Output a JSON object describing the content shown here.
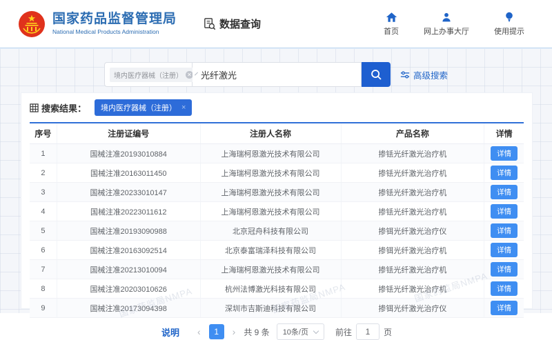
{
  "header": {
    "org_name_zh": "国家药品监督管理局",
    "org_name_en": "National Medical Products Administration",
    "app_title": "数据查询",
    "nav": [
      {
        "label": "首页",
        "icon": "home-icon"
      },
      {
        "label": "网上办事大厅",
        "icon": "user-icon"
      },
      {
        "label": "使用提示",
        "icon": "tip-icon"
      }
    ]
  },
  "search": {
    "category_tag": "境内医疗器械（注册）",
    "query": "光纤激光",
    "advanced_label": "高级搜索"
  },
  "results": {
    "label": "搜索结果：",
    "filter_tag": "境内医疗器械（注册）",
    "columns": [
      "序号",
      "注册证编号",
      "注册人名称",
      "产品名称",
      "详情"
    ],
    "detail_label": "详情",
    "rows": [
      {
        "no": "1",
        "cert": "国械注准20193010884",
        "registrant": "上海瑞柯恩激光技术有限公司",
        "product": "掺铥光纤激光治疗机"
      },
      {
        "no": "2",
        "cert": "国械注准20163011450",
        "registrant": "上海瑞柯恩激光技术有限公司",
        "product": "掺铥光纤激光治疗机"
      },
      {
        "no": "3",
        "cert": "国械注准20233010147",
        "registrant": "上海瑞柯恩激光技术有限公司",
        "product": "掺铥光纤激光治疗机"
      },
      {
        "no": "4",
        "cert": "国械注准20223011612",
        "registrant": "上海瑞柯恩激光技术有限公司",
        "product": "掺铥光纤激光治疗机"
      },
      {
        "no": "5",
        "cert": "国械注准20193090988",
        "registrant": "北京冠舟科技有限公司",
        "product": "掺铒光纤激光治疗仪"
      },
      {
        "no": "6",
        "cert": "国械注准20163092514",
        "registrant": "北京泰富瑞泽科技有限公司",
        "product": "掺铒光纤激光治疗机"
      },
      {
        "no": "7",
        "cert": "国械注准20213010094",
        "registrant": "上海瑞柯恩激光技术有限公司",
        "product": "掺铥光纤激光治疗机"
      },
      {
        "no": "8",
        "cert": "国械注准20203010626",
        "registrant": "杭州法博激光科技有限公司",
        "product": "掺铥光纤激光治疗机"
      },
      {
        "no": "9",
        "cert": "国械注准20173094398",
        "registrant": "深圳市吉斯迪科技有限公司",
        "product": "掺铒光纤激光治疗仪"
      }
    ]
  },
  "pagination": {
    "note_label": "说明",
    "prev": "‹",
    "next": "›",
    "current_page": "1",
    "total_text": "共 9 条",
    "page_size": "10条/页",
    "goto_prefix": "前往",
    "goto_value": "1",
    "goto_suffix": "页"
  },
  "watermark": "国家药监局NMPA",
  "colors": {
    "brand_blue": "#2b6cb2",
    "primary_button": "#1e5fd0",
    "tag_blue": "#2d6cd9",
    "detail_button": "#3f8ef2",
    "nav_icon_blue": "#1f64c8",
    "table_top_border": "#2f6fd8",
    "background": "#f4f6fa"
  }
}
